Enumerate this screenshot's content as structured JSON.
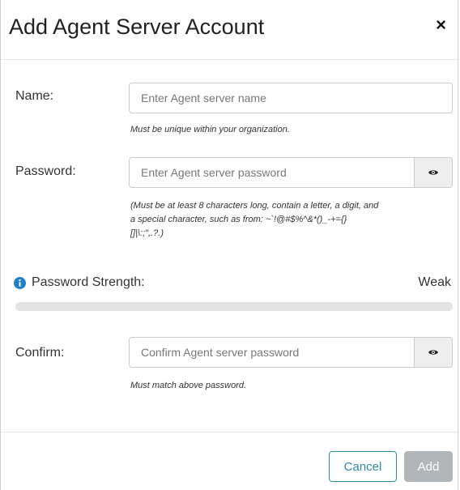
{
  "dialog": {
    "title": "Add Agent Server Account",
    "close_label": "×"
  },
  "name": {
    "label": "Name:",
    "placeholder": "Enter Agent server name",
    "value": "",
    "hint": "Must be unique within your organization."
  },
  "password": {
    "label": "Password:",
    "placeholder": "Enter Agent server password",
    "value": "",
    "hint_line1": "(Must be at least 8 characters long, contain a letter, a digit, and",
    "hint_line2": "a special character, such as from: ~`!@#$%^&*()_-+={}",
    "hint_line3": "[]|\\:;\",.?.)",
    "toggle_icon": "eye-icon"
  },
  "strength": {
    "label": "Password Strength:",
    "value": "Weak",
    "level": 0,
    "info_icon": "info-icon"
  },
  "confirm": {
    "label": "Confirm:",
    "placeholder": "Confirm Agent server password",
    "value": "",
    "hint": "Must match above password.",
    "toggle_icon": "eye-icon"
  },
  "footer": {
    "cancel_label": "Cancel",
    "add_label": "Add"
  },
  "colors": {
    "accent": "#2c8aa6",
    "info": "#1f7fc8",
    "disabled_button": "#b0b6ba",
    "progress_track": "#e3e3e3"
  }
}
